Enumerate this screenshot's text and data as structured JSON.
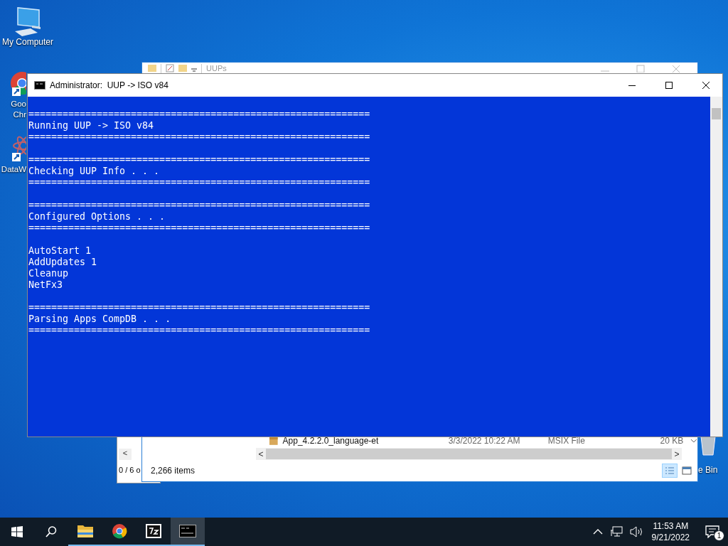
{
  "desktop_icons": [
    {
      "kind": "computer",
      "label_lines": [
        "My Computer"
      ]
    },
    {
      "kind": "chrome",
      "label_lines": [
        "Goo",
        "Chr"
      ]
    },
    {
      "kind": "atom",
      "label_lines": [
        "DataW"
      ]
    }
  ],
  "recycle_bin": {
    "label": "e Bin"
  },
  "back_window": {
    "status": "0 / 6 o",
    "scroll_left": "<"
  },
  "explorer": {
    "title": "UUPs",
    "rows": [
      {
        "name": "App_4.2.2.0_language-et",
        "date": "3/3/2022 10:22 AM",
        "type": "MSIX File",
        "size": "20 KB"
      }
    ],
    "scroll_left": "<",
    "scroll_right": ">",
    "status": "2,266 items",
    "views": [
      {
        "kind": "details",
        "selected": true
      },
      {
        "kind": "thumbnails",
        "selected": false
      }
    ]
  },
  "console": {
    "title": "Administrator:  UUP -> ISO v84",
    "sections": [
      {
        "kind": "banner",
        "rule_top": "============================================================",
        "heading": "Running UUP -> ISO v84",
        "rule_bottom": "============================================================"
      },
      {
        "kind": "banner",
        "rule_top": "============================================================",
        "heading": "Checking UUP Info . . .",
        "rule_bottom": "============================================================"
      },
      {
        "kind": "banner",
        "rule_top": "============================================================",
        "heading": "Configured Options . . .",
        "rule_bottom": "============================================================"
      },
      {
        "kind": "list",
        "lines": [
          "AutoStart 1",
          "AddUpdates 1",
          "Cleanup",
          "NetFx3"
        ]
      },
      {
        "kind": "banner",
        "rule_top": "============================================================",
        "heading": "Parsing Apps CompDB . . .",
        "rule_bottom": "============================================================"
      }
    ]
  },
  "taskbar": {
    "apps": [
      {
        "kind": "explorer",
        "running": true,
        "active": false
      },
      {
        "kind": "chrome",
        "running": true,
        "active": false
      },
      {
        "kind": "archive",
        "running": true,
        "active": false
      },
      {
        "kind": "console",
        "running": true,
        "active": true
      }
    ],
    "time": "11:53 AM",
    "date": "9/21/2022",
    "notification_count": "1"
  }
}
